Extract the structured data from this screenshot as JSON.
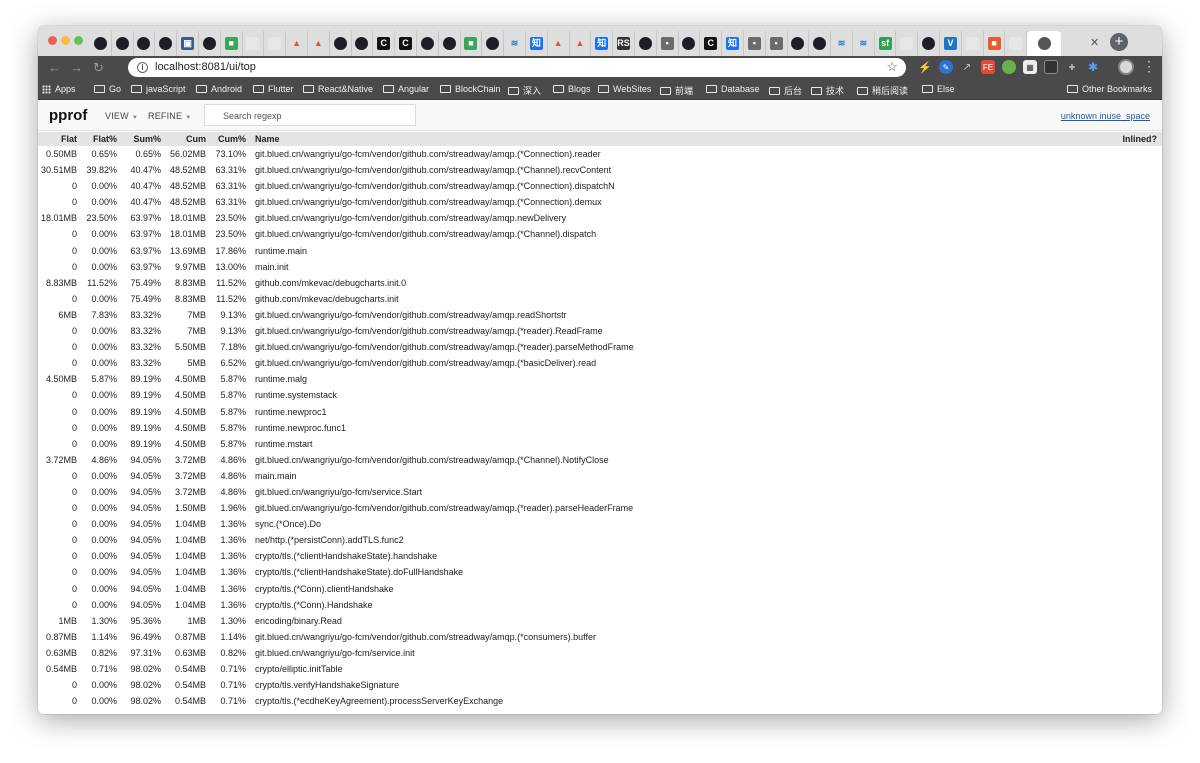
{
  "browser": {
    "address": "localhost:8081/ui/top",
    "tabs": [
      {
        "icon": "github-icon"
      },
      {
        "icon": "github-icon"
      },
      {
        "icon": "github-icon"
      },
      {
        "icon": "github-icon"
      },
      {
        "icon": "app-icon"
      },
      {
        "icon": "github-icon"
      },
      {
        "icon": "green-icon"
      },
      {
        "icon": "page-icon"
      },
      {
        "icon": "page-icon"
      },
      {
        "icon": "mountain-icon"
      },
      {
        "icon": "mountain-icon"
      },
      {
        "icon": "github-icon"
      },
      {
        "icon": "github-icon"
      },
      {
        "icon": "c-icon"
      },
      {
        "icon": "c-icon"
      },
      {
        "icon": "github-icon"
      },
      {
        "icon": "github-icon"
      },
      {
        "icon": "green-icon"
      },
      {
        "icon": "github-icon"
      },
      {
        "icon": "layers-icon"
      },
      {
        "icon": "zhihu-icon"
      },
      {
        "icon": "mountain-icon"
      },
      {
        "icon": "mountain-icon"
      },
      {
        "icon": "zhihu-icon"
      },
      {
        "icon": "rs-icon"
      },
      {
        "icon": "github-icon"
      },
      {
        "icon": "image-icon"
      },
      {
        "icon": "github-icon"
      },
      {
        "icon": "c-icon"
      },
      {
        "icon": "zhihu-icon"
      },
      {
        "icon": "image-icon"
      },
      {
        "icon": "image-icon"
      },
      {
        "icon": "github-icon"
      },
      {
        "icon": "github-icon"
      },
      {
        "icon": "layers-icon"
      },
      {
        "icon": "layers-icon"
      },
      {
        "icon": "sf-icon"
      },
      {
        "icon": "page-icon"
      },
      {
        "icon": "github-icon"
      },
      {
        "icon": "v-icon"
      },
      {
        "icon": "page-icon"
      },
      {
        "icon": "orange-icon"
      },
      {
        "icon": "page-icon"
      }
    ],
    "bookmarks": [
      {
        "label": "Apps",
        "type": "apps"
      },
      {
        "label": "Go",
        "type": "folder"
      },
      {
        "label": "javaScript",
        "type": "folder"
      },
      {
        "label": "Android",
        "type": "folder"
      },
      {
        "label": "Flutter",
        "type": "folder"
      },
      {
        "label": "React&Native",
        "type": "folder"
      },
      {
        "label": "Angular",
        "type": "folder"
      },
      {
        "label": "BlockChain",
        "type": "folder"
      },
      {
        "label": "深入",
        "type": "folder"
      },
      {
        "label": "Blogs",
        "type": "folder"
      },
      {
        "label": "WebSites",
        "type": "folder"
      },
      {
        "label": "前端",
        "type": "folder"
      },
      {
        "label": "Database",
        "type": "folder"
      },
      {
        "label": "后台",
        "type": "folder"
      },
      {
        "label": "技术",
        "type": "folder"
      },
      {
        "label": "稍后阅读",
        "type": "folder"
      },
      {
        "label": "Else",
        "type": "folder"
      }
    ],
    "other_bookmarks": "Other Bookmarks"
  },
  "pprof": {
    "title": "pprof",
    "view_label": "VIEW",
    "refine_label": "REFINE",
    "search_placeholder": "Search regexp",
    "sample_link": "unknown inuse_space"
  },
  "table": {
    "headers": {
      "flat": "Flat",
      "flat_pct": "Flat%",
      "sum_pct": "Sum%",
      "cum": "Cum",
      "cum_pct": "Cum%",
      "name": "Name",
      "inlined": "Inlined?"
    },
    "rows": [
      {
        "flat": "0.50MB",
        "flat_pct": "0.65%",
        "sum_pct": "0.65%",
        "cum": "56.02MB",
        "cum_pct": "73.10%",
        "name": "git.blued.cn/wangriyu/go-fcm/vendor/github.com/streadway/amqp.(*Connection).reader"
      },
      {
        "flat": "30.51MB",
        "flat_pct": "39.82%",
        "sum_pct": "40.47%",
        "cum": "48.52MB",
        "cum_pct": "63.31%",
        "name": "git.blued.cn/wangriyu/go-fcm/vendor/github.com/streadway/amqp.(*Channel).recvContent"
      },
      {
        "flat": "0",
        "flat_pct": "0.00%",
        "sum_pct": "40.47%",
        "cum": "48.52MB",
        "cum_pct": "63.31%",
        "name": "git.blued.cn/wangriyu/go-fcm/vendor/github.com/streadway/amqp.(*Connection).dispatchN"
      },
      {
        "flat": "0",
        "flat_pct": "0.00%",
        "sum_pct": "40.47%",
        "cum": "48.52MB",
        "cum_pct": "63.31%",
        "name": "git.blued.cn/wangriyu/go-fcm/vendor/github.com/streadway/amqp.(*Connection).demux"
      },
      {
        "flat": "18.01MB",
        "flat_pct": "23.50%",
        "sum_pct": "63.97%",
        "cum": "18.01MB",
        "cum_pct": "23.50%",
        "name": "git.blued.cn/wangriyu/go-fcm/vendor/github.com/streadway/amqp.newDelivery"
      },
      {
        "flat": "0",
        "flat_pct": "0.00%",
        "sum_pct": "63.97%",
        "cum": "18.01MB",
        "cum_pct": "23.50%",
        "name": "git.blued.cn/wangriyu/go-fcm/vendor/github.com/streadway/amqp.(*Channel).dispatch"
      },
      {
        "flat": "0",
        "flat_pct": "0.00%",
        "sum_pct": "63.97%",
        "cum": "13.69MB",
        "cum_pct": "17.86%",
        "name": "runtime.main"
      },
      {
        "flat": "0",
        "flat_pct": "0.00%",
        "sum_pct": "63.97%",
        "cum": "9.97MB",
        "cum_pct": "13.00%",
        "name": "main.init"
      },
      {
        "flat": "8.83MB",
        "flat_pct": "11.52%",
        "sum_pct": "75.49%",
        "cum": "8.83MB",
        "cum_pct": "11.52%",
        "name": "github.com/mkevac/debugcharts.init.0"
      },
      {
        "flat": "0",
        "flat_pct": "0.00%",
        "sum_pct": "75.49%",
        "cum": "8.83MB",
        "cum_pct": "11.52%",
        "name": "github.com/mkevac/debugcharts.init"
      },
      {
        "flat": "6MB",
        "flat_pct": "7.83%",
        "sum_pct": "83.32%",
        "cum": "7MB",
        "cum_pct": "9.13%",
        "name": "git.blued.cn/wangriyu/go-fcm/vendor/github.com/streadway/amqp.readShortstr"
      },
      {
        "flat": "0",
        "flat_pct": "0.00%",
        "sum_pct": "83.32%",
        "cum": "7MB",
        "cum_pct": "9.13%",
        "name": "git.blued.cn/wangriyu/go-fcm/vendor/github.com/streadway/amqp.(*reader).ReadFrame"
      },
      {
        "flat": "0",
        "flat_pct": "0.00%",
        "sum_pct": "83.32%",
        "cum": "5.50MB",
        "cum_pct": "7.18%",
        "name": "git.blued.cn/wangriyu/go-fcm/vendor/github.com/streadway/amqp.(*reader).parseMethodFrame"
      },
      {
        "flat": "0",
        "flat_pct": "0.00%",
        "sum_pct": "83.32%",
        "cum": "5MB",
        "cum_pct": "6.52%",
        "name": "git.blued.cn/wangriyu/go-fcm/vendor/github.com/streadway/amqp.(*basicDeliver).read"
      },
      {
        "flat": "4.50MB",
        "flat_pct": "5.87%",
        "sum_pct": "89.19%",
        "cum": "4.50MB",
        "cum_pct": "5.87%",
        "name": "runtime.malg"
      },
      {
        "flat": "0",
        "flat_pct": "0.00%",
        "sum_pct": "89.19%",
        "cum": "4.50MB",
        "cum_pct": "5.87%",
        "name": "runtime.systemstack"
      },
      {
        "flat": "0",
        "flat_pct": "0.00%",
        "sum_pct": "89.19%",
        "cum": "4.50MB",
        "cum_pct": "5.87%",
        "name": "runtime.newproc1"
      },
      {
        "flat": "0",
        "flat_pct": "0.00%",
        "sum_pct": "89.19%",
        "cum": "4.50MB",
        "cum_pct": "5.87%",
        "name": "runtime.newproc.func1"
      },
      {
        "flat": "0",
        "flat_pct": "0.00%",
        "sum_pct": "89.19%",
        "cum": "4.50MB",
        "cum_pct": "5.87%",
        "name": "runtime.mstart"
      },
      {
        "flat": "3.72MB",
        "flat_pct": "4.86%",
        "sum_pct": "94.05%",
        "cum": "3.72MB",
        "cum_pct": "4.86%",
        "name": "git.blued.cn/wangriyu/go-fcm/vendor/github.com/streadway/amqp.(*Channel).NotifyClose"
      },
      {
        "flat": "0",
        "flat_pct": "0.00%",
        "sum_pct": "94.05%",
        "cum": "3.72MB",
        "cum_pct": "4.86%",
        "name": "main.main"
      },
      {
        "flat": "0",
        "flat_pct": "0.00%",
        "sum_pct": "94.05%",
        "cum": "3.72MB",
        "cum_pct": "4.86%",
        "name": "git.blued.cn/wangriyu/go-fcm/service.Start"
      },
      {
        "flat": "0",
        "flat_pct": "0.00%",
        "sum_pct": "94.05%",
        "cum": "1.50MB",
        "cum_pct": "1.96%",
        "name": "git.blued.cn/wangriyu/go-fcm/vendor/github.com/streadway/amqp.(*reader).parseHeaderFrame"
      },
      {
        "flat": "0",
        "flat_pct": "0.00%",
        "sum_pct": "94.05%",
        "cum": "1.04MB",
        "cum_pct": "1.36%",
        "name": "sync.(*Once).Do"
      },
      {
        "flat": "0",
        "flat_pct": "0.00%",
        "sum_pct": "94.05%",
        "cum": "1.04MB",
        "cum_pct": "1.36%",
        "name": "net/http.(*persistConn).addTLS.func2"
      },
      {
        "flat": "0",
        "flat_pct": "0.00%",
        "sum_pct": "94.05%",
        "cum": "1.04MB",
        "cum_pct": "1.36%",
        "name": "crypto/tls.(*clientHandshakeState).handshake"
      },
      {
        "flat": "0",
        "flat_pct": "0.00%",
        "sum_pct": "94.05%",
        "cum": "1.04MB",
        "cum_pct": "1.36%",
        "name": "crypto/tls.(*clientHandshakeState).doFullHandshake"
      },
      {
        "flat": "0",
        "flat_pct": "0.00%",
        "sum_pct": "94.05%",
        "cum": "1.04MB",
        "cum_pct": "1.36%",
        "name": "crypto/tls.(*Conn).clientHandshake"
      },
      {
        "flat": "0",
        "flat_pct": "0.00%",
        "sum_pct": "94.05%",
        "cum": "1.04MB",
        "cum_pct": "1.36%",
        "name": "crypto/tls.(*Conn).Handshake"
      },
      {
        "flat": "1MB",
        "flat_pct": "1.30%",
        "sum_pct": "95.36%",
        "cum": "1MB",
        "cum_pct": "1.30%",
        "name": "encoding/binary.Read"
      },
      {
        "flat": "0.87MB",
        "flat_pct": "1.14%",
        "sum_pct": "96.49%",
        "cum": "0.87MB",
        "cum_pct": "1.14%",
        "name": "git.blued.cn/wangriyu/go-fcm/vendor/github.com/streadway/amqp.(*consumers).buffer"
      },
      {
        "flat": "0.63MB",
        "flat_pct": "0.82%",
        "sum_pct": "97.31%",
        "cum": "0.63MB",
        "cum_pct": "0.82%",
        "name": "git.blued.cn/wangriyu/go-fcm/service.init"
      },
      {
        "flat": "0.54MB",
        "flat_pct": "0.71%",
        "sum_pct": "98.02%",
        "cum": "0.54MB",
        "cum_pct": "0.71%",
        "name": "crypto/elliptic.initTable"
      },
      {
        "flat": "0",
        "flat_pct": "0.00%",
        "sum_pct": "98.02%",
        "cum": "0.54MB",
        "cum_pct": "0.71%",
        "name": "crypto/tls.verifyHandshakeSignature"
      },
      {
        "flat": "0",
        "flat_pct": "0.00%",
        "sum_pct": "98.02%",
        "cum": "0.54MB",
        "cum_pct": "0.71%",
        "name": "crypto/tls.(*ecdheKeyAgreement).processServerKeyExchange"
      }
    ]
  }
}
